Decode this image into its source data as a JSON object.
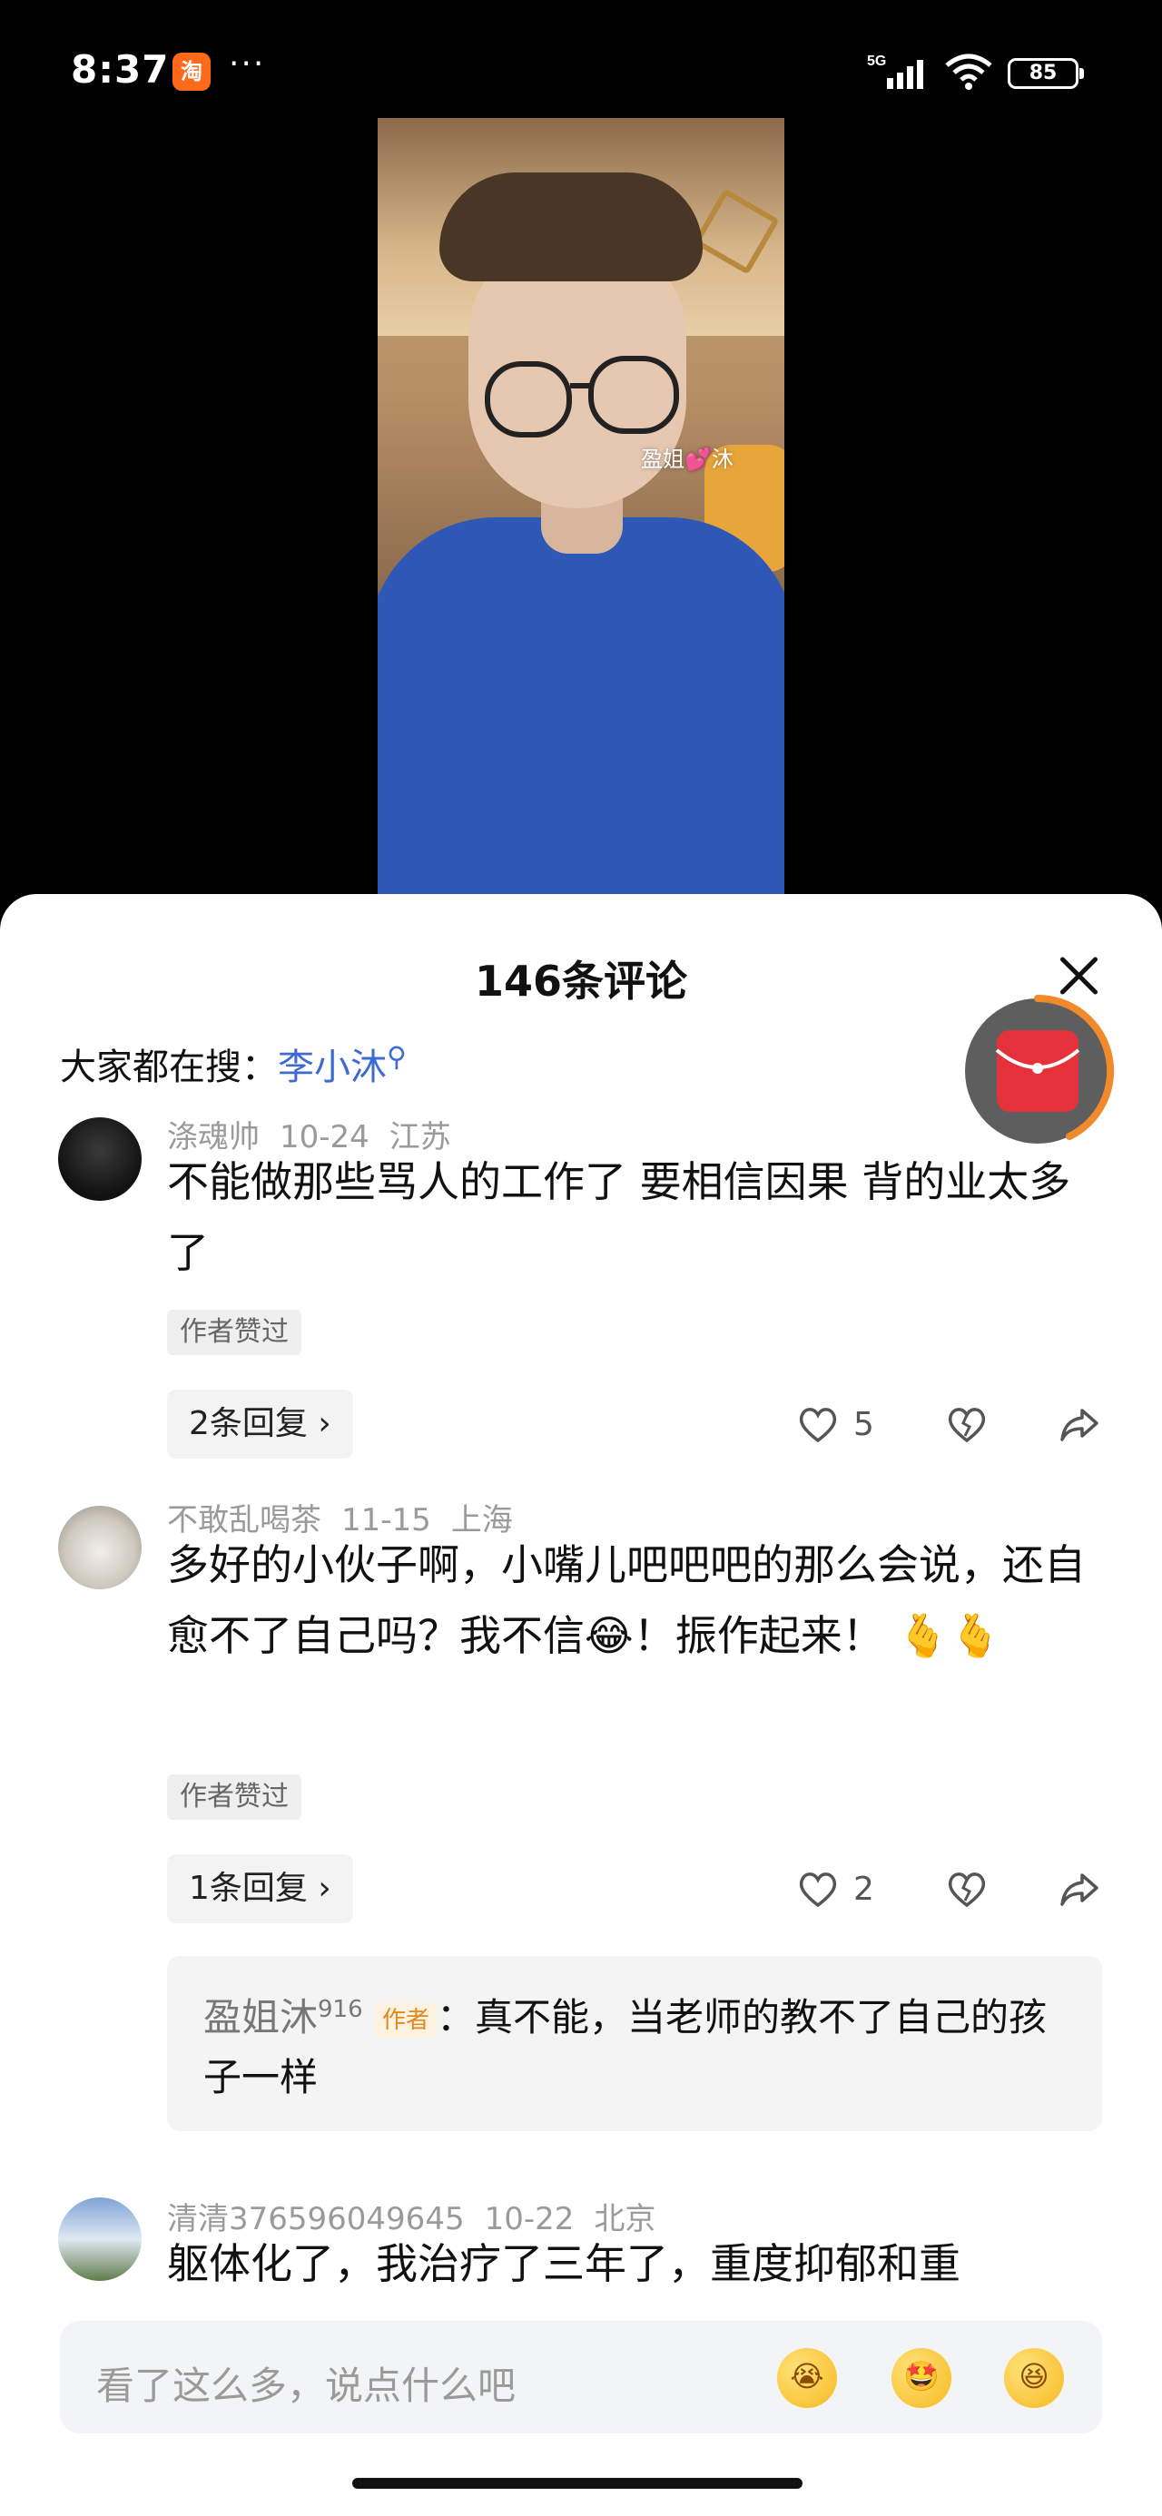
{
  "status_bar": {
    "time": "8:37",
    "app_icon_label": "淘",
    "more": "···",
    "network": "5G",
    "battery": "85"
  },
  "video": {
    "watermark": "盈姐💕沐"
  },
  "comment_sheet": {
    "title": "146条评论",
    "search_hint_prefix": "大家都在搜：",
    "search_hint_keyword": "李小沐"
  },
  "comments": [
    {
      "user": "涤魂帅",
      "date": "10-24",
      "location": "江苏",
      "text": "不能做那些骂人的工作了 要相信因果 背的业太多了",
      "badge": "作者赞过",
      "reply_btn": "2条回复",
      "likes": "5"
    },
    {
      "user": "不敢乱喝茶",
      "date": "11-15",
      "location": "上海",
      "text": "多好的小伙子啊，小嘴儿吧吧吧的那么会说，还自愈不了自己吗？我不信😂！振作起来！ 🫰🫰",
      "badge": "作者赞过",
      "reply_btn": "1条回复",
      "likes": "2",
      "author_reply": {
        "name": "盈姐沐",
        "sup": "916",
        "tag": "作者",
        "text": "：真不能，当老师的教不了自己的孩子一样"
      }
    },
    {
      "user": "清清376596049645",
      "date": "10-22",
      "location": "北京",
      "text": "躯体化了，我治疗了三年了，重度抑郁和重"
    }
  ],
  "input_bar": {
    "placeholder": "看了这么多，说点什么吧",
    "emojis": [
      "😭",
      "🤩",
      "😆"
    ]
  },
  "icons": {
    "like": "heart-outline-icon",
    "dislike": "broken-heart-icon",
    "share": "share-arrow-icon",
    "close": "close-icon",
    "red_packet": "red-envelope-icon"
  },
  "colors": {
    "accent_link": "#3d6bd1",
    "author_tag": "#e08a1a",
    "red_packet": "#e5313a",
    "progress_ring": "#f08a2a"
  }
}
